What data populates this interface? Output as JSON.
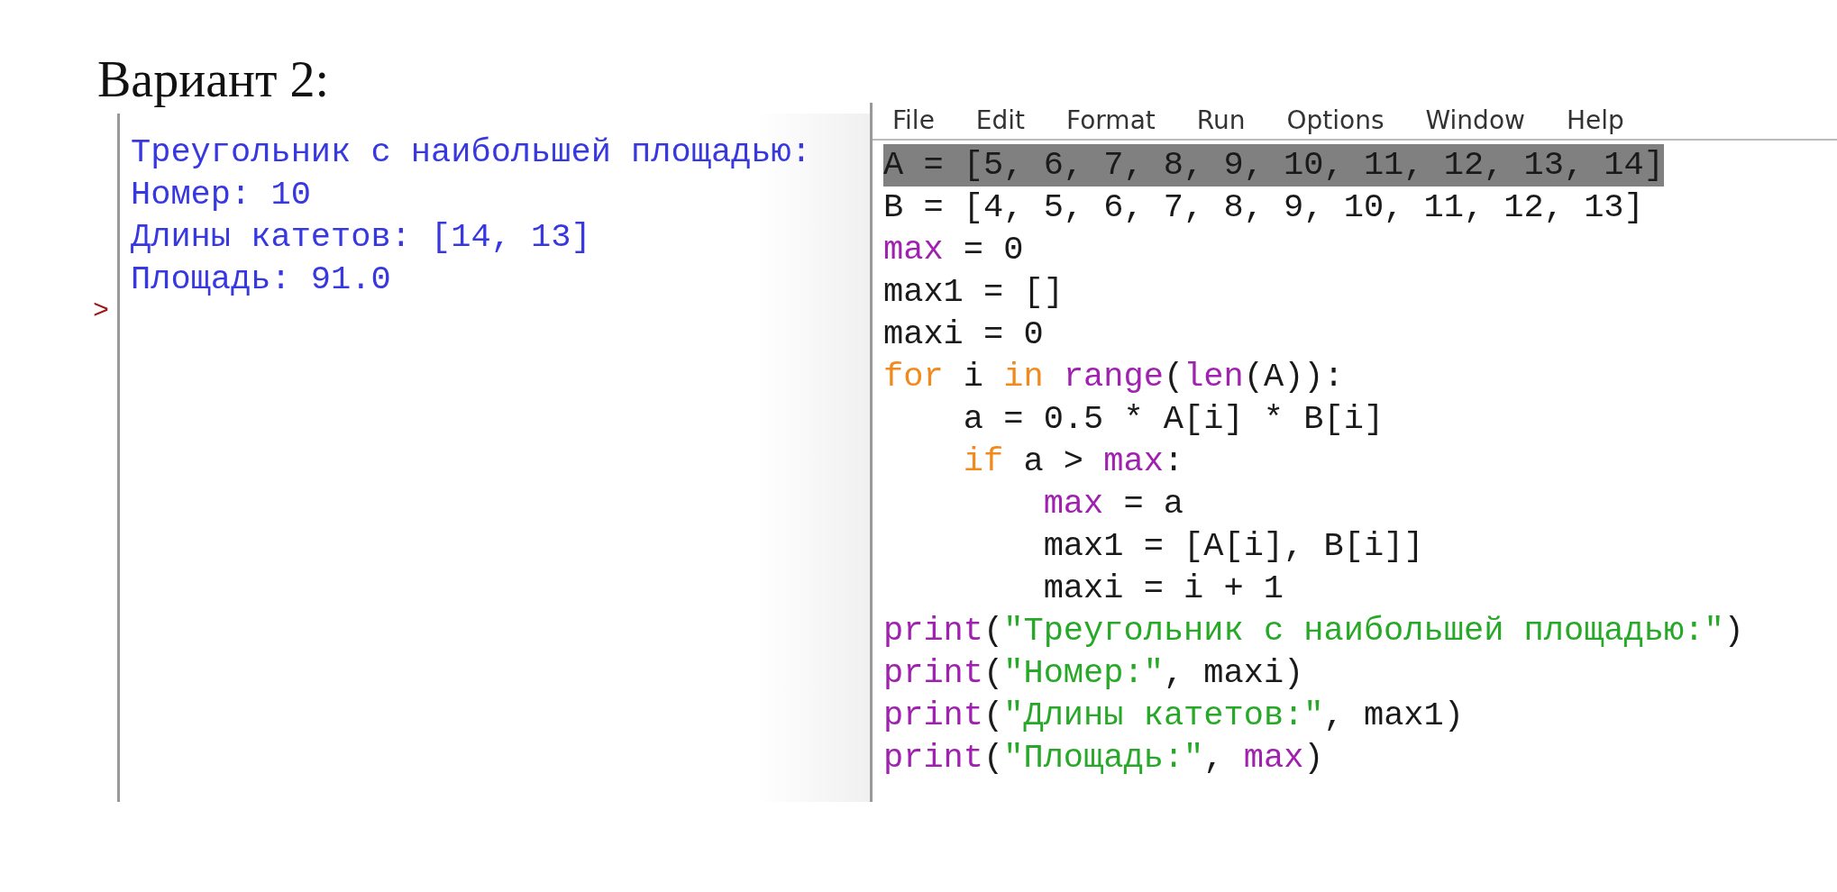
{
  "heading": "Вариант 2:",
  "shell": {
    "output": [
      "Треугольник с наибольшей площадью:",
      "Номер: 10",
      "Длины катетов: [14, 13]",
      "Площадь: 91.0"
    ],
    "prompt": ">"
  },
  "editor": {
    "menu": [
      "File",
      "Edit",
      "Format",
      "Run",
      "Options",
      "Window",
      "Help"
    ],
    "lines": [
      {
        "selected": true,
        "tokens": [
          {
            "kind": "plain",
            "text": "A = [5, 6, 7, 8, 9, 10, 11, 12, 13, 14]"
          }
        ]
      },
      {
        "selected": false,
        "tokens": [
          {
            "kind": "plain",
            "text": "B = [4, 5, 6, 7, 8, 9, 10, 11, 12, 13]"
          }
        ]
      },
      {
        "selected": false,
        "tokens": [
          {
            "kind": "builtin",
            "text": "max"
          },
          {
            "kind": "plain",
            "text": " = 0"
          }
        ]
      },
      {
        "selected": false,
        "tokens": [
          {
            "kind": "plain",
            "text": "max1 = []"
          }
        ]
      },
      {
        "selected": false,
        "tokens": [
          {
            "kind": "plain",
            "text": "maxi = 0"
          }
        ]
      },
      {
        "selected": false,
        "tokens": [
          {
            "kind": "keyword",
            "text": "for"
          },
          {
            "kind": "plain",
            "text": " i "
          },
          {
            "kind": "keyword",
            "text": "in "
          },
          {
            "kind": "builtin",
            "text": "range"
          },
          {
            "kind": "plain",
            "text": "("
          },
          {
            "kind": "builtin",
            "text": "len"
          },
          {
            "kind": "plain",
            "text": "(A)):"
          }
        ]
      },
      {
        "selected": false,
        "tokens": [
          {
            "kind": "plain",
            "text": "    a = 0.5 * A[i] * B[i]"
          }
        ]
      },
      {
        "selected": false,
        "tokens": [
          {
            "kind": "keyword",
            "text": "    if"
          },
          {
            "kind": "plain",
            "text": " a > "
          },
          {
            "kind": "builtin",
            "text": "max"
          },
          {
            "kind": "plain",
            "text": ":"
          }
        ]
      },
      {
        "selected": false,
        "tokens": [
          {
            "kind": "builtin",
            "text": "        max"
          },
          {
            "kind": "plain",
            "text": " = a"
          }
        ]
      },
      {
        "selected": false,
        "tokens": [
          {
            "kind": "plain",
            "text": "        max1 = [A[i], B[i]]"
          }
        ]
      },
      {
        "selected": false,
        "tokens": [
          {
            "kind": "plain",
            "text": "        maxi = i + 1"
          }
        ]
      },
      {
        "selected": false,
        "tokens": [
          {
            "kind": "builtin",
            "text": "print"
          },
          {
            "kind": "plain",
            "text": "("
          },
          {
            "kind": "string",
            "text": "\"Треугольник с наибольшей площадью:\""
          },
          {
            "kind": "plain",
            "text": ")"
          }
        ]
      },
      {
        "selected": false,
        "tokens": [
          {
            "kind": "builtin",
            "text": "print"
          },
          {
            "kind": "plain",
            "text": "("
          },
          {
            "kind": "string",
            "text": "\"Номер:\""
          },
          {
            "kind": "plain",
            "text": ", maxi)"
          }
        ]
      },
      {
        "selected": false,
        "tokens": [
          {
            "kind": "builtin",
            "text": "print"
          },
          {
            "kind": "plain",
            "text": "("
          },
          {
            "kind": "string",
            "text": "\"Длины катетов:\""
          },
          {
            "kind": "plain",
            "text": ", max1)"
          }
        ]
      },
      {
        "selected": false,
        "tokens": [
          {
            "kind": "builtin",
            "text": "print"
          },
          {
            "kind": "plain",
            "text": "("
          },
          {
            "kind": "string",
            "text": "\"Площадь:\""
          },
          {
            "kind": "plain",
            "text": ", "
          },
          {
            "kind": "builtin",
            "text": "max"
          },
          {
            "kind": "plain",
            "text": ")"
          }
        ]
      }
    ]
  }
}
